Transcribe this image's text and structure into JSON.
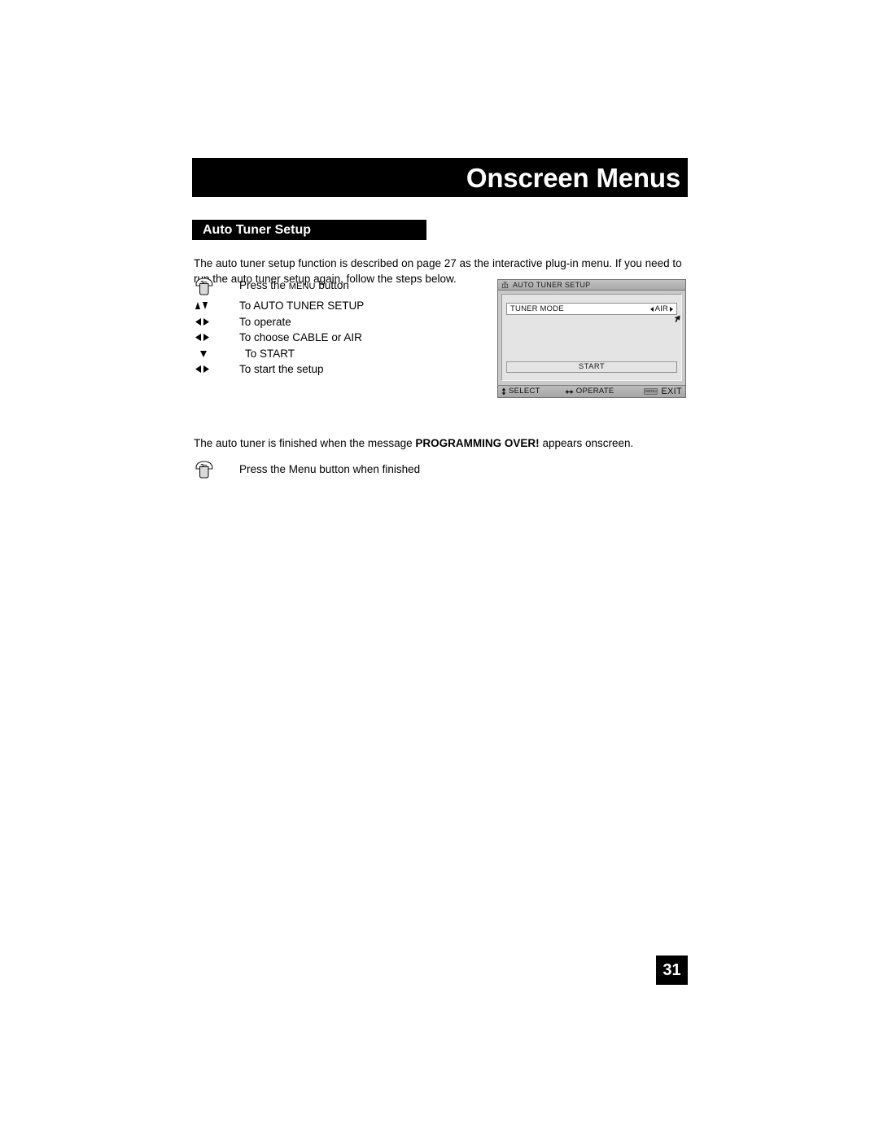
{
  "header": {
    "title": "Onscreen Menus"
  },
  "section": {
    "title": "Auto Tuner Setup"
  },
  "intro": {
    "text": "The auto tuner setup function is described on page 27 as the interactive plug-in menu.  If you need to run the auto tuner setup again, follow the steps below."
  },
  "steps": [
    {
      "symbol": "button-icon",
      "text_prefix": "Press the ",
      "text_caps": "Menu",
      "text_suffix": " button"
    },
    {
      "symbol": "up-down-arrows",
      "text": "To AUTO TUNER SETUP"
    },
    {
      "symbol": "left-right-arrows",
      "text": "To operate"
    },
    {
      "symbol": "left-right-arrows",
      "text": "To choose CABLE or AIR"
    },
    {
      "symbol": "down-arrow",
      "text": "To START"
    },
    {
      "symbol": "left-right-arrows",
      "text": "To start the setup"
    }
  ],
  "osd": {
    "title": "AUTO TUNER SETUP",
    "title_icon": "tuner-icon",
    "row": {
      "label": "TUNER MODE",
      "value": "AIR",
      "left_arrow": "left-arrow-icon",
      "right_arrow": "right-arrow-icon"
    },
    "cursor_icon": "pointer-cursor-icon",
    "start_button": "START",
    "footer": {
      "select_icon": "up-down-arrow-icon",
      "select_label": "SELECT",
      "operate_icon": "left-right-arrow-icon",
      "operate_label": "OPERATE",
      "exit_chip": "MENU",
      "exit_label": "EXIT"
    }
  },
  "finish_note": {
    "before": "The auto tuner is finished when the message ",
    "bold": "PROGRAMMING OVER!",
    "after": " appears onscreen."
  },
  "final_step": {
    "symbol": "button-icon",
    "text": "Press the Menu button when finished"
  },
  "page_number": "31",
  "colors": {
    "banner": "#000000",
    "banner_text": "#ffffff",
    "osd_panel": "#e4e4e4",
    "osd_chrome": "#b0b0b0"
  }
}
